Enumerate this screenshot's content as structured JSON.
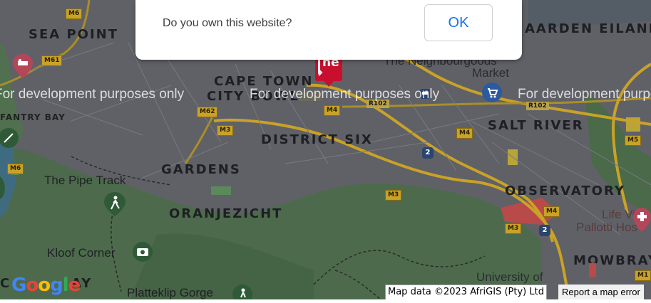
{
  "dialog": {
    "message": "Do you own this website?",
    "ok_label": "OK"
  },
  "watermark": {
    "text": "For development purposes only"
  },
  "areas": {
    "sea_point": "SEA POINT",
    "cape_town": "CAPE TOWN",
    "city_bowl": "CITY BOWL",
    "district_six": "DISTRICT SIX",
    "salt_river": "SALT RIVER",
    "gardens": "GARDENS",
    "oranjezicht": "ORANJEZICHT",
    "observatory": "OBSERVATORY",
    "mowbray": "MOWBRAY",
    "fantry_bay": "FANTRY BAY",
    "aarden_eiland": "AARDEN EILAND",
    "c_bay": "C",
    "ay": "AY"
  },
  "pois": {
    "pipe_track": "The Pipe Track",
    "kloof_corner": "Kloof Corner",
    "platteklip": "Platteklip Gorge",
    "university": "University of",
    "life_vin": "Life Vin",
    "pallotti": "Pallotti Hos",
    "neighbourgoods": "The Neighbourgoods",
    "market": "Market"
  },
  "roads": {
    "m6": "M6",
    "m61": "M61",
    "m62": "M62",
    "m3": "M3",
    "m4": "M4",
    "m5": "M5",
    "r102": "R102",
    "m1": "M1",
    "n2": "2"
  },
  "attribution": {
    "map_data": "Map data ©2023 AfriGIS (Pty) Ltd",
    "report": "Report a map error"
  },
  "logo": {
    "text": "Google"
  },
  "marker": {
    "text": "ne"
  },
  "colors": {
    "map_base": "#5f6167",
    "park_green": "#4d6b4c",
    "water": "#3f6b80",
    "road_major": "#c9a227",
    "ok_blue": "#1a73e8",
    "marker_red": "#c8102e"
  }
}
